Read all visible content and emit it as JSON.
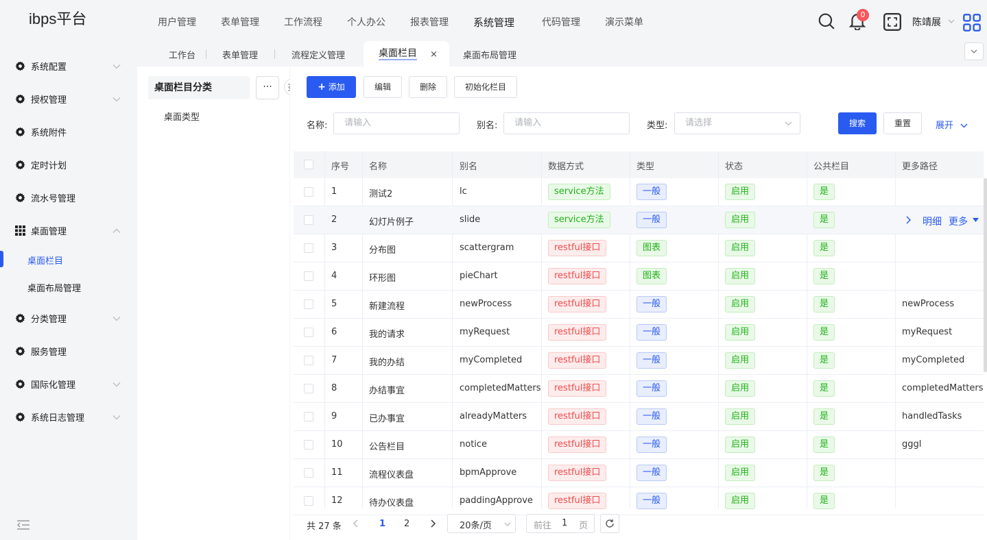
{
  "app": {
    "logo": "ibps平台"
  },
  "topnav": [
    {
      "label": "用户管理",
      "active": false
    },
    {
      "label": "表单管理",
      "active": false
    },
    {
      "label": "工作流程",
      "active": false
    },
    {
      "label": "个人办公",
      "active": false
    },
    {
      "label": "报表管理",
      "active": false
    },
    {
      "label": "系统管理",
      "active": true
    },
    {
      "label": "代码管理",
      "active": false
    },
    {
      "label": "演示菜单",
      "active": false
    }
  ],
  "header": {
    "notification_count": "0",
    "username": "陈靖展"
  },
  "sidebar": {
    "items": [
      {
        "label": "系统配置",
        "icon": "gear-icon",
        "chevron": "down"
      },
      {
        "label": "授权管理",
        "icon": "gear-icon",
        "chevron": "down"
      },
      {
        "label": "系统附件",
        "icon": "gear-icon",
        "chevron": ""
      },
      {
        "label": "定时计划",
        "icon": "gear-icon",
        "chevron": ""
      },
      {
        "label": "流水号管理",
        "icon": "gear-icon",
        "chevron": ""
      },
      {
        "label": "桌面管理",
        "icon": "grid-icon",
        "chevron": "up"
      },
      {
        "label": "分类管理",
        "icon": "gear-icon",
        "chevron": "down"
      },
      {
        "label": "服务管理",
        "icon": "gear-icon",
        "chevron": ""
      },
      {
        "label": "国际化管理",
        "icon": "gear-icon",
        "chevron": "down"
      },
      {
        "label": "系统日志管理",
        "icon": "gear-icon",
        "chevron": "down"
      }
    ],
    "subitems": [
      {
        "label": "桌面栏目",
        "active": true
      },
      {
        "label": "桌面布局管理",
        "active": false
      }
    ]
  },
  "tabs": [
    {
      "label": "工作台"
    },
    {
      "label": "表单管理"
    },
    {
      "label": "流程定义管理"
    },
    {
      "label": "桌面栏目",
      "active": true
    },
    {
      "label": "桌面布局管理"
    }
  ],
  "tree": {
    "title": "桌面栏目分类",
    "more": "···",
    "items": [
      "桌面类型"
    ]
  },
  "toolbar": {
    "add": "添加",
    "edit": "编辑",
    "delete": "删除",
    "init": "初始化栏目"
  },
  "filters": {
    "name_label": "名称:",
    "name_placeholder": "请输入",
    "alias_label": "别名:",
    "alias_placeholder": "请输入",
    "type_label": "类型:",
    "type_placeholder": "请选择",
    "search": "搜索",
    "reset": "重置",
    "expand": "展开"
  },
  "table": {
    "columns": [
      "序号",
      "名称",
      "别名",
      "数据方式",
      "类型",
      "状态",
      "公共栏目",
      "更多路径"
    ],
    "row_actions": {
      "detail": "明细",
      "more": "更多"
    },
    "rows": [
      {
        "no": "1",
        "name": "测试2",
        "alias": "lc",
        "data_mode": "service方法",
        "data_mode_color": "green",
        "type": "一般",
        "type_color": "blue",
        "status": "启用",
        "public": "是",
        "path": ""
      },
      {
        "no": "2",
        "name": "幻灯片例子",
        "alias": "slide",
        "data_mode": "service方法",
        "data_mode_color": "green",
        "type": "一般",
        "type_color": "blue",
        "status": "启用",
        "public": "是",
        "path": ""
      },
      {
        "no": "3",
        "name": "分布图",
        "alias": "scattergram",
        "data_mode": "restful接口",
        "data_mode_color": "red",
        "type": "图表",
        "type_color": "green",
        "status": "启用",
        "public": "是",
        "path": ""
      },
      {
        "no": "4",
        "name": "环形图",
        "alias": "pieChart",
        "data_mode": "restful接口",
        "data_mode_color": "red",
        "type": "图表",
        "type_color": "green",
        "status": "启用",
        "public": "是",
        "path": ""
      },
      {
        "no": "5",
        "name": "新建流程",
        "alias": "newProcess",
        "data_mode": "restful接口",
        "data_mode_color": "red",
        "type": "一般",
        "type_color": "blue",
        "status": "启用",
        "public": "是",
        "path": "newProcess"
      },
      {
        "no": "6",
        "name": "我的请求",
        "alias": "myRequest",
        "data_mode": "restful接口",
        "data_mode_color": "red",
        "type": "一般",
        "type_color": "blue",
        "status": "启用",
        "public": "是",
        "path": "myRequest"
      },
      {
        "no": "7",
        "name": "我的办结",
        "alias": "myCompleted",
        "data_mode": "restful接口",
        "data_mode_color": "red",
        "type": "一般",
        "type_color": "blue",
        "status": "启用",
        "public": "是",
        "path": "myCompleted"
      },
      {
        "no": "8",
        "name": "办结事宜",
        "alias": "completedMatters",
        "data_mode": "restful接口",
        "data_mode_color": "red",
        "type": "一般",
        "type_color": "blue",
        "status": "启用",
        "public": "是",
        "path": "completedMatters"
      },
      {
        "no": "9",
        "name": "已办事宜",
        "alias": "alreadyMatters",
        "data_mode": "restful接口",
        "data_mode_color": "red",
        "type": "一般",
        "type_color": "blue",
        "status": "启用",
        "public": "是",
        "path": "handledTasks"
      },
      {
        "no": "10",
        "name": "公告栏目",
        "alias": "notice",
        "data_mode": "restful接口",
        "data_mode_color": "red",
        "type": "一般",
        "type_color": "blue",
        "status": "启用",
        "public": "是",
        "path": "gggl"
      },
      {
        "no": "11",
        "name": "流程仪表盘",
        "alias": "bpmApprove",
        "data_mode": "restful接口",
        "data_mode_color": "red",
        "type": "一般",
        "type_color": "blue",
        "status": "启用",
        "public": "是",
        "path": ""
      },
      {
        "no": "12",
        "name": "待办仪表盘",
        "alias": "paddingApprove",
        "data_mode": "restful接口",
        "data_mode_color": "red",
        "type": "一般",
        "type_color": "blue",
        "status": "启用",
        "public": "是",
        "path": ""
      }
    ]
  },
  "pagination": {
    "total": "共 27 条",
    "pages": [
      "1",
      "2"
    ],
    "current": "1",
    "page_size": "20条/页",
    "goto_prefix": "前往",
    "goto_value": "1",
    "goto_suffix": "页"
  },
  "colors": {
    "accent": "#2a5bf0",
    "green": "#1fb318",
    "red": "#f04a4a",
    "badge": "#f5575b"
  }
}
